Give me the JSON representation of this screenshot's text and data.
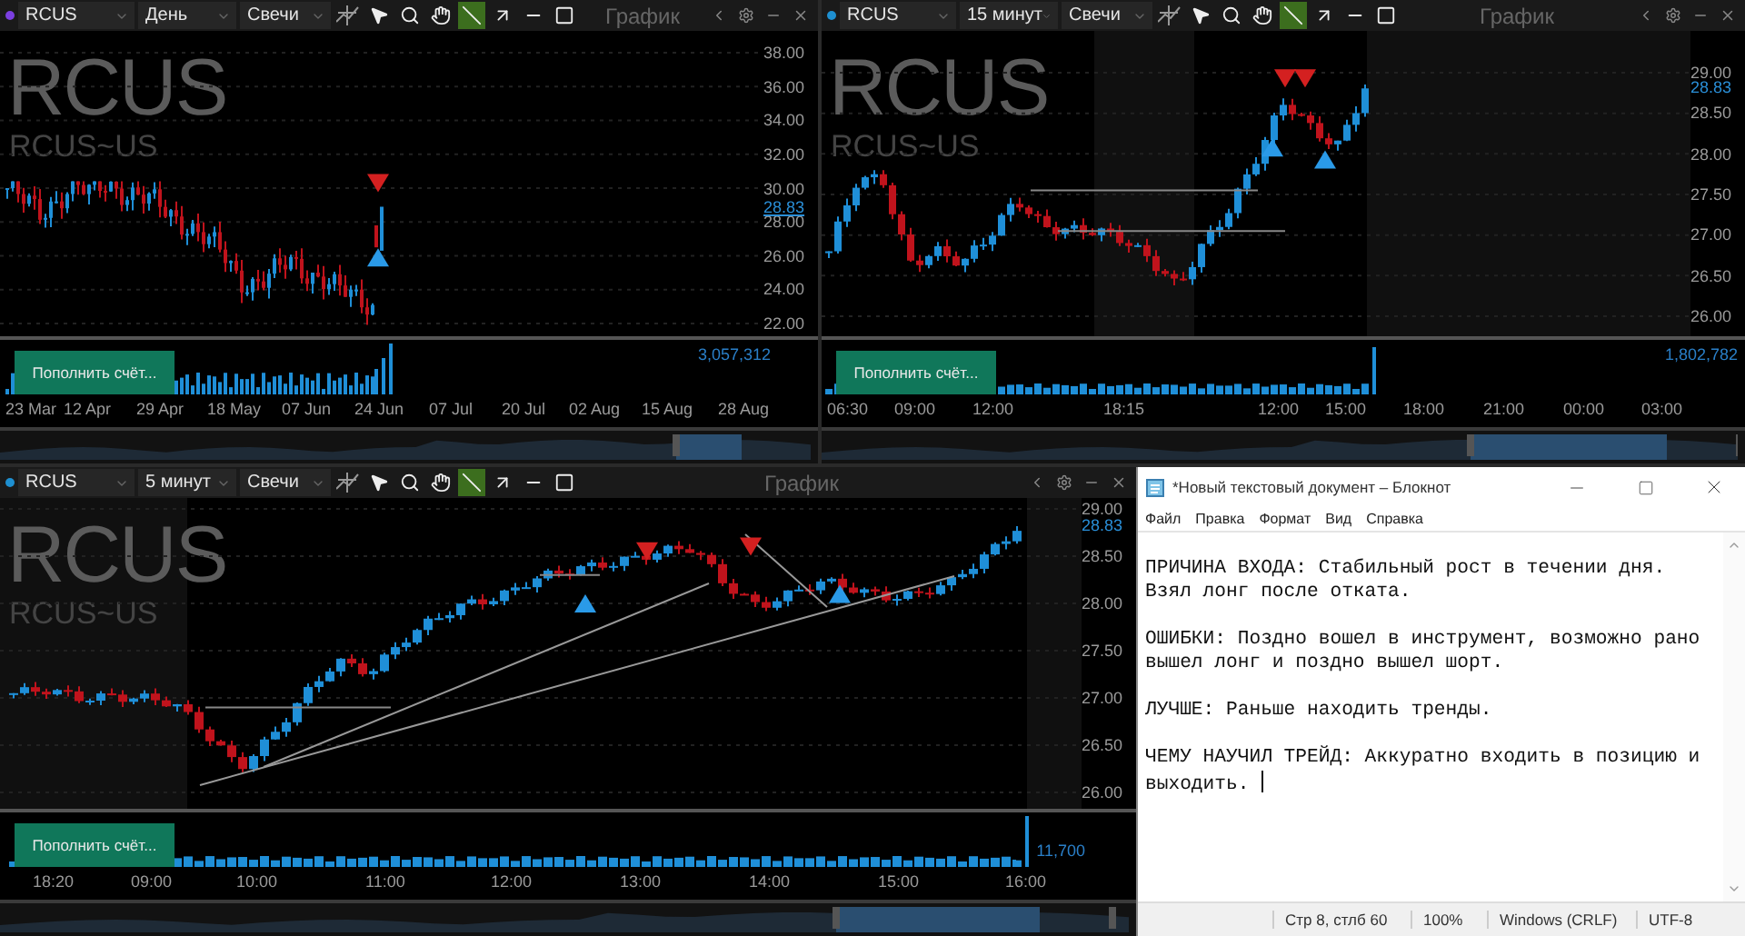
{
  "charts": [
    {
      "color": "#7b3fe0",
      "symbol": "RCUS",
      "interval": "День",
      "style": "Свечи",
      "tools": [
        {
          "kind": "graph",
          "selected": false
        },
        {
          "kind": "pointer",
          "selected": false
        },
        {
          "kind": "zoom",
          "selected": false
        },
        {
          "kind": "pan",
          "selected": false
        },
        {
          "kind": "line",
          "selected": true
        },
        {
          "kind": "arrow",
          "selected": false
        },
        {
          "kind": "hline",
          "selected": false
        },
        {
          "kind": "rect",
          "selected": false
        }
      ],
      "title": "График",
      "background_symbol": "RCUS",
      "background_name": "RCUS~US",
      "price_ticks": [
        "38.00",
        "36.00",
        "34.00",
        "32.00",
        "30.00",
        "28.00",
        "26.00",
        "24.00",
        "22.00"
      ],
      "last_price": "28.83",
      "volume_reading": "3,057,312",
      "deposit_button": "Пополнить счёт...",
      "time_ticks": [
        "23 Mar",
        "12 Apr",
        "29 Apr",
        "18 May",
        "07 Jun",
        "24 Jun",
        "07 Jul",
        "20 Jul",
        "02 Aug",
        "15 Aug",
        "28 Aug"
      ]
    },
    {
      "color": "#1e8fd0",
      "symbol": "RCUS",
      "interval": "15 минут",
      "style": "Свечи",
      "tools": [
        {
          "kind": "graph",
          "selected": false
        },
        {
          "kind": "pointer",
          "selected": false
        },
        {
          "kind": "zoom",
          "selected": false
        },
        {
          "kind": "pan",
          "selected": false
        },
        {
          "kind": "line",
          "selected": true
        },
        {
          "kind": "arrow",
          "selected": false
        },
        {
          "kind": "hline",
          "selected": false
        },
        {
          "kind": "rect",
          "selected": false
        }
      ],
      "title": "График",
      "background_symbol": "RCUS",
      "background_name": "RCUS~US",
      "price_ticks": [
        "29.00",
        "28.50",
        "28.00",
        "27.50",
        "27.00",
        "26.50",
        "26.00"
      ],
      "last_price": "28.83",
      "volume_reading": "1,802,782",
      "deposit_button": "Пополнить счёт...",
      "time_ticks": [
        "06:30",
        "09:00",
        "12:00",
        "18:15",
        "12:00",
        "15:00",
        "18:00",
        "21:00",
        "00:00",
        "03:00"
      ]
    },
    {
      "color": "#1e8fd0",
      "symbol": "RCUS",
      "interval": "5 минут",
      "style": "Свечи",
      "tools": [
        {
          "kind": "graph",
          "selected": false
        },
        {
          "kind": "pointer",
          "selected": false
        },
        {
          "kind": "zoom",
          "selected": false
        },
        {
          "kind": "pan",
          "selected": false
        },
        {
          "kind": "line",
          "selected": true
        },
        {
          "kind": "arrow",
          "selected": false
        },
        {
          "kind": "hline",
          "selected": false
        },
        {
          "kind": "rect",
          "selected": false
        }
      ],
      "title": "График",
      "background_symbol": "RCUS",
      "background_name": "RCUS~US",
      "price_ticks": [
        "29.00",
        "28.50",
        "28.00",
        "27.50",
        "27.00",
        "26.50",
        "26.00"
      ],
      "last_price": "28.83",
      "volume_reading": "11,700",
      "deposit_button": "Пополнить счёт...",
      "time_ticks": [
        "18:20",
        "09:00",
        "10:00",
        "11:00",
        "12:00",
        "13:00",
        "14:00",
        "15:00",
        "16:00"
      ]
    }
  ],
  "notepad": {
    "title": "*Новый текстовый документ – Блокнот",
    "menu": [
      "Файл",
      "Правка",
      "Формат",
      "Вид",
      "Справка"
    ],
    "paragraphs": [
      [
        "ПРИЧИНА ВХОДА: Стабильный рост в течении дня.",
        "Взял лонг после отката."
      ],
      [
        "ОШИБКИ: Поздно вошел в инструмент, возможно рано",
        "вышел лонг и поздно вышел шорт."
      ],
      [
        "ЛУЧШЕ: Раньше находить тренды."
      ],
      [
        "ЧЕМУ НАУЧИЛ ТРЕЙД: Аккуратно входить в позицию и",
        "выходить. "
      ]
    ],
    "status": [
      "Стр 8, стлб 60",
      "100%",
      "Windows (CRLF)",
      "UTF-8"
    ]
  }
}
